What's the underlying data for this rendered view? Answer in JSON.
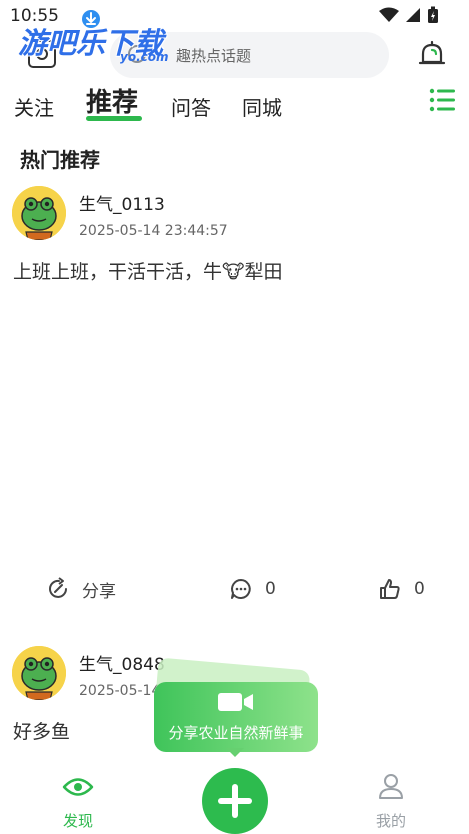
{
  "status_bar": {
    "time": "10:55"
  },
  "watermark": {
    "logo_text": "游吧乐下载",
    "domain": "yo.com",
    "download_icon": "download-icon"
  },
  "header": {
    "scan_icon": "scan-icon",
    "search_placeholder": "趣热点话题",
    "bell_icon": "bell-icon"
  },
  "tabs": [
    {
      "label": "关注"
    },
    {
      "label": "推荐",
      "active": true
    },
    {
      "label": "问答"
    },
    {
      "label": "同城"
    }
  ],
  "menu_icon": "list-menu-icon",
  "section_title": "热门推荐",
  "posts": [
    {
      "username": "生气_0113",
      "time": "2025-05-14 23:44:57",
      "content": "上班上班，干活干活，牛",
      "emoji": "🐮",
      "content_suffix": "犁田",
      "share_label": "分享",
      "comment_count": "0",
      "like_count": "0"
    },
    {
      "username": "生气_0848",
      "time": "2025-05-14",
      "content": "好多鱼"
    }
  ],
  "tooltip": {
    "text": "分享农业自然新鲜事",
    "icon": "video-camera-icon"
  },
  "bottom_nav": {
    "discover_label": "发现",
    "profile_label": "我的"
  },
  "colors": {
    "brand_green": "#2dbb4e",
    "tab_underline": "#2db84d",
    "inactive_gray": "#9aa0a6"
  }
}
